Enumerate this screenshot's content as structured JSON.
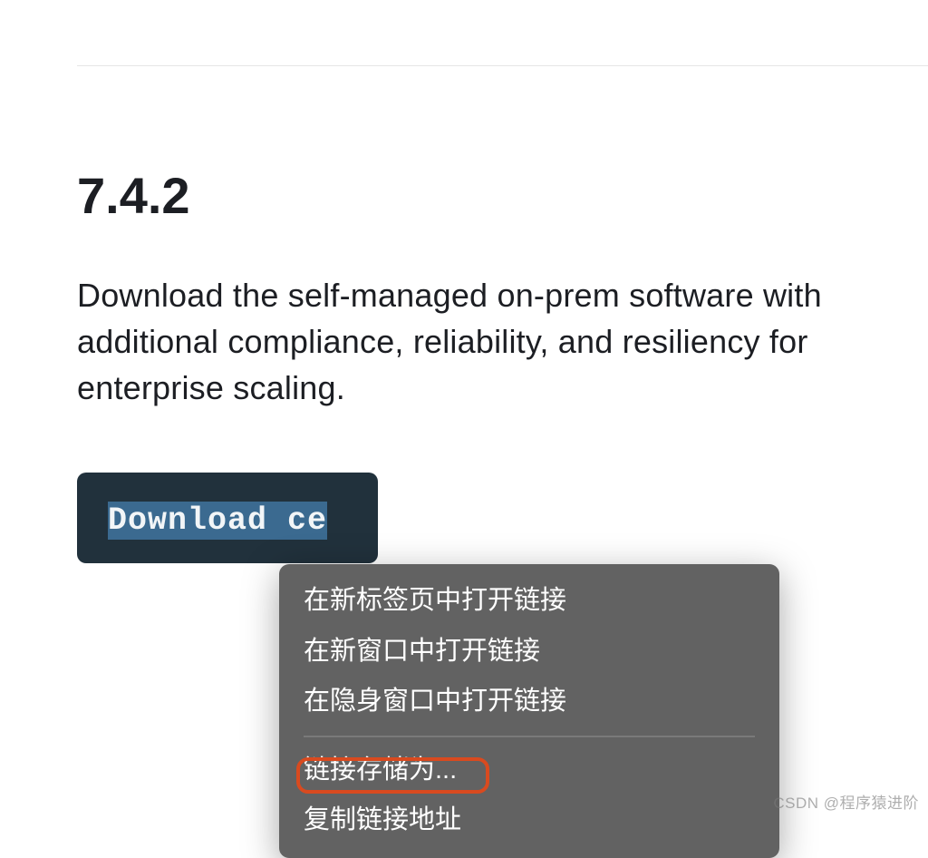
{
  "page": {
    "version_heading": "7.4.2",
    "description": "Download the self-managed on-prem software with additional compliance, reliability, and resiliency for enterprise scaling.",
    "download_button_label": "Download ce"
  },
  "context_menu": {
    "items": [
      "在新标签页中打开链接",
      "在新窗口中打开链接",
      "在隐身窗口中打开链接"
    ],
    "items2": [
      "链接存储为...",
      "复制链接地址"
    ]
  },
  "watermark": "CSDN @程序猿进阶"
}
